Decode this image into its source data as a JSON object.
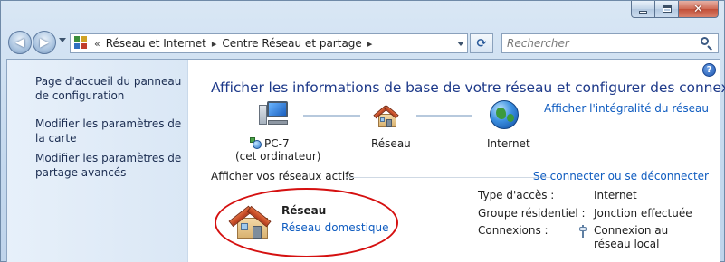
{
  "window": {
    "controls": [
      "minimize-icon",
      "maximize-icon",
      "close-icon"
    ],
    "close_color": "#c24f38"
  },
  "nav": {
    "back_icon": "back-arrow-icon",
    "forward_icon": "forward-arrow-icon",
    "breadcrumb_prefix": "«",
    "breadcrumb": [
      "Réseau et Internet",
      "Centre Réseau et partage"
    ],
    "search": {
      "placeholder": "Rechercher",
      "value": ""
    }
  },
  "sidebar": {
    "links": [
      "Page d'accueil du panneau de configuration",
      "Modifier les paramètres de la carte",
      "Modifier les paramètres de partage avancés"
    ]
  },
  "main": {
    "title": "Afficher les informations de base de votre réseau et configurer des connexions",
    "full_map_link": "Afficher l'intégralité du réseau",
    "map": {
      "computer_name": "PC-7",
      "computer_sub": "(cet ordinateur)",
      "network": "Réseau",
      "internet": "Internet"
    },
    "active_section": {
      "title": "Afficher vos réseaux actifs",
      "connect_link": "Se connecter ou se déconnecter",
      "network_name": "Réseau",
      "network_type": "Réseau domestique",
      "access_type_label": "Type d'accès :",
      "access_type_value": "Internet",
      "homegroup_label": "Groupe résidentiel :",
      "homegroup_value": "Jonction effectuée",
      "connections_label": "Connexions :",
      "connections_value": "Connexion au réseau local"
    }
  },
  "colors": {
    "link": "#0f5cc0",
    "title": "#1e3a8a",
    "highlight_ellipse": "#d51010"
  }
}
